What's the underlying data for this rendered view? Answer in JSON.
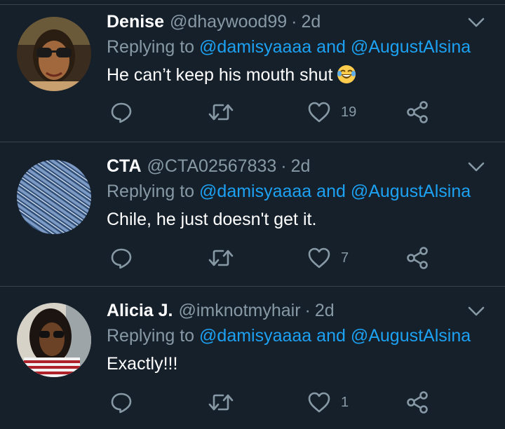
{
  "thread": {
    "tweets": [
      {
        "name": "Denise",
        "handle": "@dhaywood99",
        "separator": "·",
        "time": "2d",
        "reply_prefix": "Replying to",
        "mention_1": "@damisyaaaa",
        "reply_and": "and",
        "mention_2": "@AugustAlsina",
        "text": "He can’t keep his mouth shut",
        "emoji": "face-with-tears-of-joy",
        "likes": "19",
        "avatar": "photo-woman-sunglasses"
      },
      {
        "name": "CTA",
        "handle": "@CTA02567833",
        "separator": "·",
        "time": "2d",
        "reply_prefix": "Replying to",
        "mention_1": "@damisyaaaa",
        "reply_and": "and",
        "mention_2": "@AugustAlsina",
        "text": "Chile, he just doesn't get it.",
        "likes": "7",
        "avatar": "photo-denim-texture"
      },
      {
        "name": "Alicia J.",
        "handle": "@imknotmyhair",
        "separator": "·",
        "time": "2d",
        "reply_prefix": "Replying to",
        "mention_1": "@damisyaaaa",
        "reply_and": "and",
        "mention_2": "@AugustAlsina",
        "text": "Exactly!!!",
        "likes": "1",
        "avatar": "photo-woman-braids-sunglasses"
      }
    ]
  },
  "icons": {
    "reply": "reply-icon",
    "retweet": "retweet-icon",
    "like": "heart-icon",
    "share": "share-icon",
    "more": "chevron-down-icon"
  },
  "colors": {
    "background": "#15202b",
    "divider": "#38444d",
    "secondary_text": "#8899a6",
    "mention": "#1da1f2",
    "primary_text": "#ffffff"
  }
}
